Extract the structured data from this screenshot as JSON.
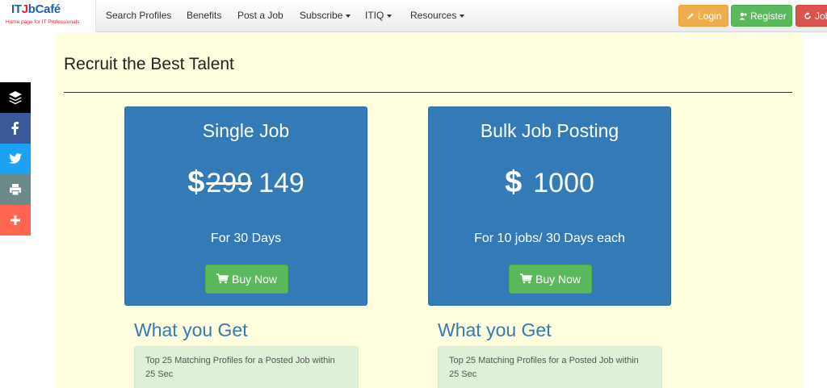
{
  "brand": {
    "logo_text_prefix": "IT",
    "logo_text_accent": "J",
    "logo_text_suffix": "bCafé",
    "tagline": "Home page for IT Professionals"
  },
  "nav": {
    "items": [
      {
        "label": "Search Profiles"
      },
      {
        "label": "Benefits"
      },
      {
        "label": "Post a Job"
      },
      {
        "label": "Subscribe"
      },
      {
        "label": "ITIQ"
      },
      {
        "label": "Resources"
      }
    ],
    "login_label": "Login",
    "register_label": "Register",
    "jobs_label": "Jobs"
  },
  "page": {
    "title": "Recruit the Best Talent"
  },
  "plans": [
    {
      "title": "Single Job",
      "currency": "$",
      "old_price": "299",
      "price": "149",
      "subtitle": "For 30 Days",
      "button_label": "Buy Now",
      "section_title": "What you Get",
      "feature": "Top 25 Matching Profiles for a Posted Job within 25 Sec"
    },
    {
      "title": "Bulk Job Posting",
      "currency": "$",
      "price": "1000",
      "subtitle": "For 10 jobs/ 30 Days each",
      "button_label": "Buy Now",
      "section_title": "What you Get",
      "feature": "Top 25 Matching Profiles for a Posted Job within 25 Sec"
    }
  ],
  "social": [
    {
      "icon": "buffer-icon",
      "color": "#000000"
    },
    {
      "icon": "facebook-icon",
      "color": "#3b5998"
    },
    {
      "icon": "twitter-icon",
      "color": "#1da1f2"
    },
    {
      "icon": "print-icon",
      "color": "#6d8a8a"
    },
    {
      "icon": "plus-icon",
      "color": "#ff6550"
    }
  ],
  "colors": {
    "primary": "#337ab7",
    "success": "#5cb85c",
    "warning": "#f0ad4e",
    "danger": "#d9534f",
    "page_bg": "#ffffe0"
  }
}
